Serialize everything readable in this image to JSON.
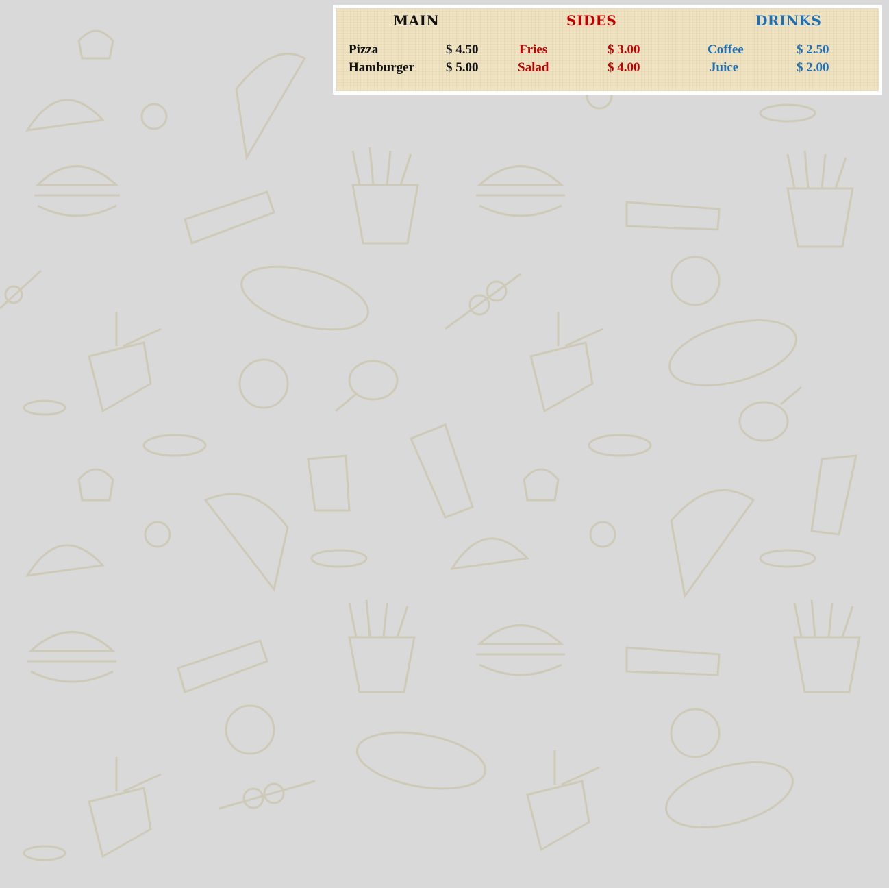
{
  "colors": {
    "page_background": "#d9d9d9",
    "board_background": "#efe3c2",
    "board_border": "#ffffff",
    "main_color": "#111111",
    "sides_color": "#c00000",
    "drinks_color": "#1f6fb5"
  },
  "menu": {
    "main": {
      "title": "MAIN",
      "items": [
        {
          "name": "Pizza",
          "price": "$ 4.50"
        },
        {
          "name": "Hamburger",
          "price": "$ 5.00"
        }
      ]
    },
    "sides": {
      "title": "SIDES",
      "items": [
        {
          "name": "Fries",
          "price": "$ 3.00"
        },
        {
          "name": "Salad",
          "price": "$ 4.00"
        }
      ]
    },
    "drinks": {
      "title": "DRINKS",
      "items": [
        {
          "name": "Coffee",
          "price": "$ 2.50"
        },
        {
          "name": "Juice",
          "price": "$ 2.00"
        }
      ]
    }
  },
  "background_icons": [
    "pizza-slice-icon",
    "hamburger-icon",
    "fries-icon",
    "sandwich-icon",
    "hot-dog-icon",
    "taco-icon",
    "pretzel-icon",
    "chicken-leg-icon",
    "drink-cup-icon",
    "noodle-box-icon",
    "kebab-icon",
    "cupcake-icon"
  ]
}
